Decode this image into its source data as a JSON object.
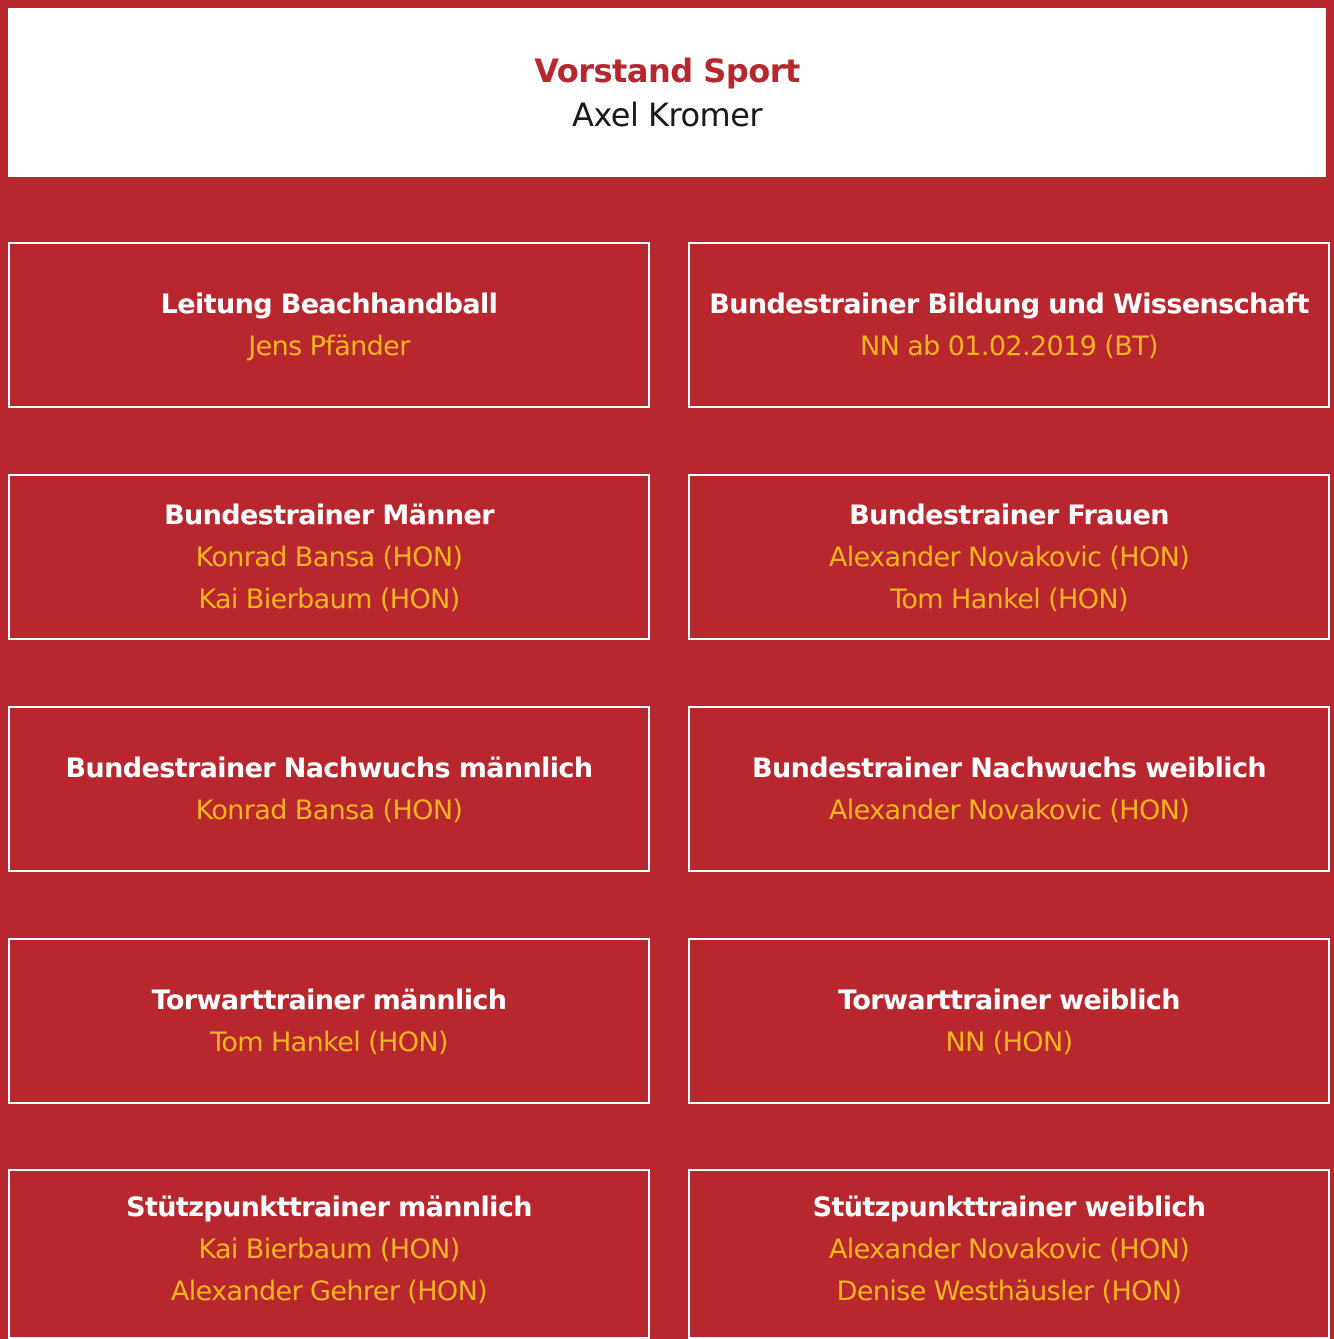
{
  "colors": {
    "background": "#b8262e",
    "title_text": "#ffffff",
    "person_text": "#f2b51e",
    "top_box": "#ffffff"
  },
  "head": {
    "title": "Vorstand Sport",
    "name": "Axel Kromer"
  },
  "boxes": [
    {
      "title": "Leitung Beachhandball",
      "persons": [
        "Jens Pfänder"
      ]
    },
    {
      "title": "Bundestrainer Bildung und Wissenschaft",
      "persons": [
        "NN ab 01.02.2019 (BT)"
      ]
    },
    {
      "title": "Bundestrainer Männer",
      "persons": [
        "Konrad Bansa (HON)",
        "Kai Bierbaum (HON)"
      ]
    },
    {
      "title": "Bundestrainer Frauen",
      "persons": [
        "Alexander Novakovic (HON)",
        "Tom Hankel (HON)"
      ]
    },
    {
      "title": "Bundestrainer Nachwuchs männlich",
      "persons": [
        "Konrad Bansa (HON)"
      ]
    },
    {
      "title": "Bundestrainer Nachwuchs weiblich",
      "persons": [
        "Alexander Novakovic (HON)"
      ]
    },
    {
      "title": "Torwarttrainer männlich",
      "persons": [
        "Tom Hankel (HON)"
      ]
    },
    {
      "title": "Torwarttrainer weiblich",
      "persons": [
        "NN (HON)"
      ]
    },
    {
      "title": "Stützpunkttrainer männlich",
      "persons": [
        "Kai Bierbaum (HON)",
        "Alexander Gehrer (HON)"
      ]
    },
    {
      "title": "Stützpunkttrainer weiblich",
      "persons": [
        "Alexander Novakovic (HON)",
        "Denise Westhäusler (HON)"
      ]
    }
  ]
}
